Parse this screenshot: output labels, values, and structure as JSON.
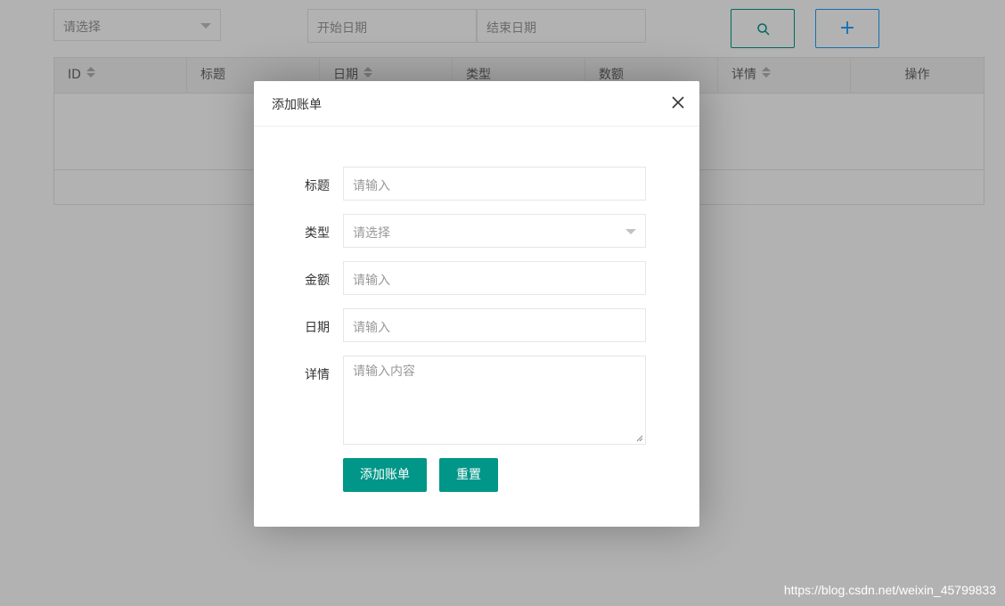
{
  "toolbar": {
    "type_select_placeholder": "请选择",
    "start_date_placeholder": "开始日期",
    "end_date_placeholder": "结束日期",
    "search_icon": "search-icon",
    "add_label": "+"
  },
  "table": {
    "columns": [
      {
        "label": "ID",
        "sortable": true
      },
      {
        "label": "标题",
        "sortable": false
      },
      {
        "label": "日期",
        "sortable": true
      },
      {
        "label": "类型",
        "sortable": false
      },
      {
        "label": "数额",
        "sortable": false
      },
      {
        "label": "详情",
        "sortable": true
      },
      {
        "label": "操作",
        "sortable": false
      }
    ]
  },
  "modal": {
    "title": "添加账单",
    "close_icon": "close-icon",
    "fields": [
      {
        "label": "标题",
        "placeholder": "请输入",
        "kind": "input"
      },
      {
        "label": "类型",
        "placeholder": "请选择",
        "kind": "select"
      },
      {
        "label": "金额",
        "placeholder": "请输入",
        "kind": "input"
      },
      {
        "label": "日期",
        "placeholder": "请输入",
        "kind": "input"
      },
      {
        "label": "详情",
        "placeholder": "请输入内容",
        "kind": "textarea"
      }
    ],
    "submit_label": "添加账单",
    "reset_label": "重置"
  },
  "watermark": "https://blog.csdn.net/weixin_45799833",
  "colors": {
    "primary": "#009688",
    "blue": "#1e9fff",
    "overlay": "rgba(0,0,0,0.3)"
  }
}
